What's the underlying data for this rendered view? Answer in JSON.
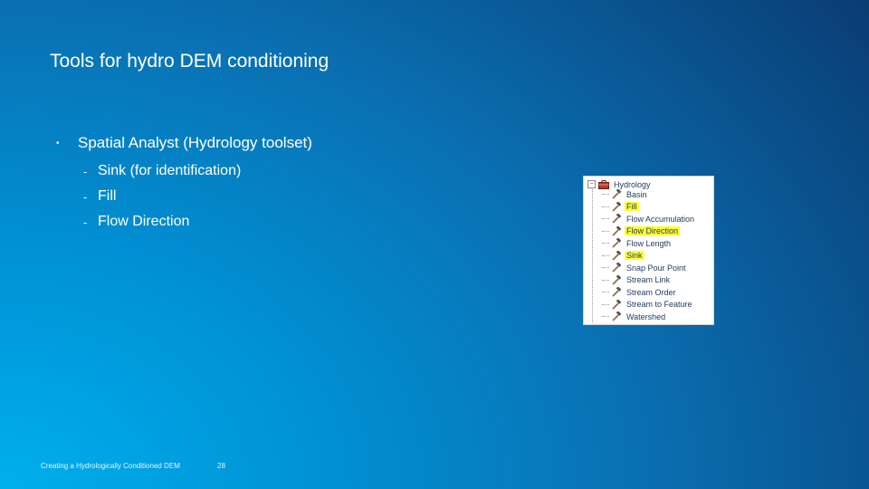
{
  "slide": {
    "title": "Tools for hydro DEM conditioning",
    "bullet": "Spatial Analyst (Hydrology toolset)",
    "sub_bullets": [
      "Sink (for identification)",
      "Fill",
      "Flow Direction"
    ]
  },
  "tree": {
    "root_label": "Hydrology",
    "items": [
      {
        "label": "Basin",
        "highlighted": false
      },
      {
        "label": "Fill",
        "highlighted": true
      },
      {
        "label": "Flow Accumulation",
        "highlighted": false
      },
      {
        "label": "Flow Direction",
        "highlighted": true
      },
      {
        "label": "Flow Length",
        "highlighted": false
      },
      {
        "label": "Sink",
        "highlighted": true
      },
      {
        "label": "Snap Pour Point",
        "highlighted": false
      },
      {
        "label": "Stream Link",
        "highlighted": false
      },
      {
        "label": "Stream Order",
        "highlighted": false
      },
      {
        "label": "Stream to Feature",
        "highlighted": false
      },
      {
        "label": "Watershed",
        "highlighted": false
      }
    ],
    "highlight_color": "#ffff33"
  },
  "footer": {
    "text": "Creating a Hydrologically Conditioned DEM",
    "page_number": "28"
  }
}
